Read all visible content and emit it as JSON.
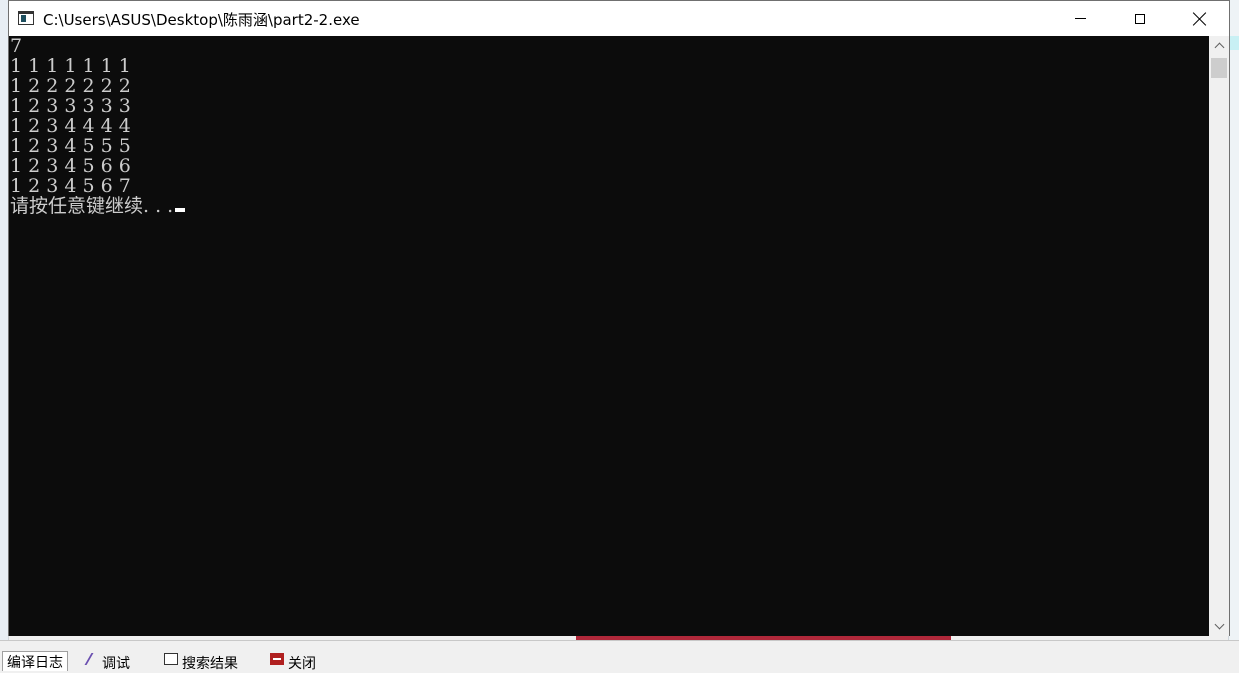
{
  "window": {
    "title": "C:\\Users\\ASUS\\Desktop\\陈雨涵\\part2-2.exe",
    "controls": {
      "minimize": "minimize-icon",
      "maximize": "maximize-icon",
      "close": "close-icon"
    }
  },
  "console": {
    "lines": [
      "7",
      "1 1 1 1 1 1 1",
      "1 2 2 2 2 2 2",
      "1 2 3 3 3 3 3",
      "1 2 3 4 4 4 4",
      "1 2 3 4 5 5 5",
      "1 2 3 4 5 6 6",
      "1 2 3 4 5 6 7"
    ],
    "prompt": "请按任意键继续. . .",
    "background_color": "#0c0c0c",
    "text_color": "#cccccc"
  },
  "bottom_tabs": [
    {
      "label": "编译日志",
      "icon": "log-icon",
      "active": true
    },
    {
      "label": "调试",
      "icon": "debug-icon",
      "active": false
    },
    {
      "label": "搜索结果",
      "icon": "search-results-icon",
      "active": false
    },
    {
      "label": "关闭",
      "icon": "close-tab-icon",
      "active": false
    }
  ]
}
